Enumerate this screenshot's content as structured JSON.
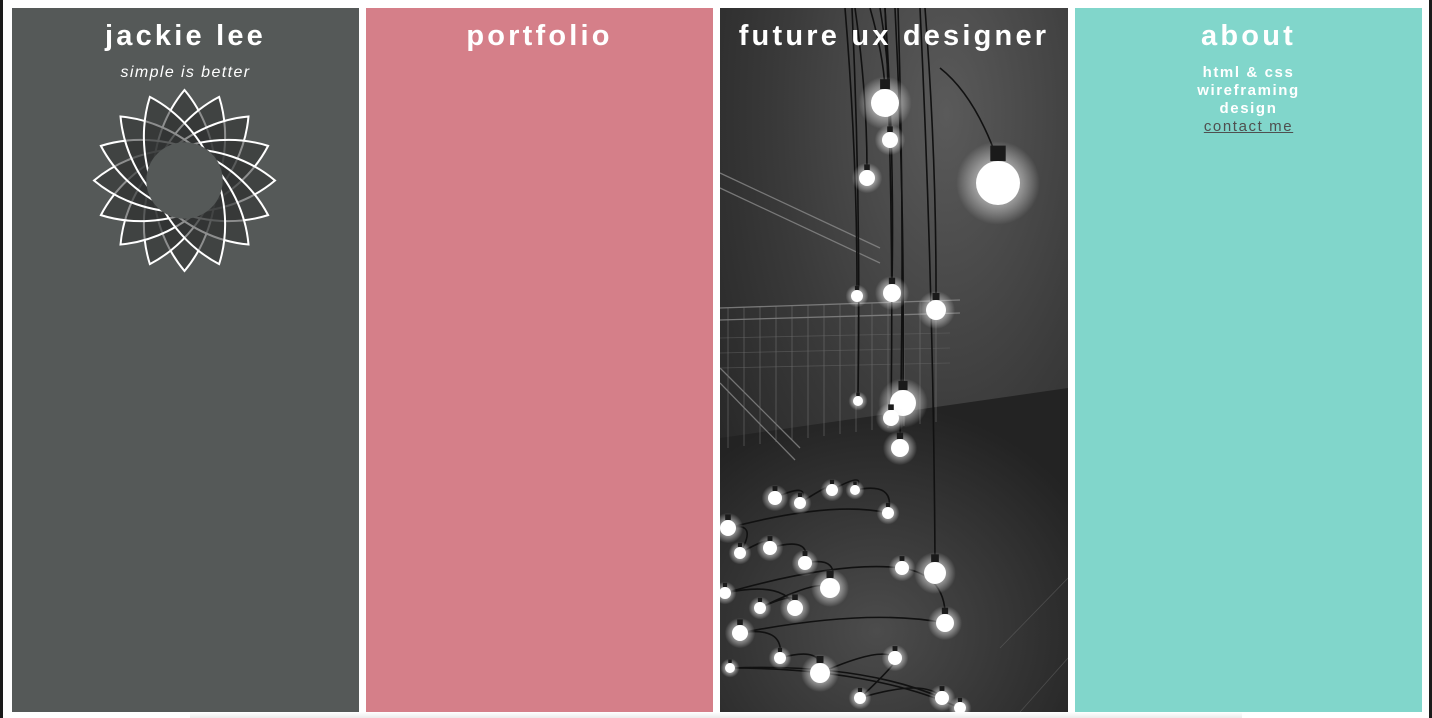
{
  "colors": {
    "panel_1": "#555958",
    "panel_2": "#d57f89",
    "panel_3": "#3a3a3a",
    "panel_4": "#81d6cb",
    "text": "#ffffff",
    "link": "#4f4f4f"
  },
  "panels": {
    "name": {
      "title": "jackie lee",
      "tagline": "simple is better",
      "icon": "flower-logo-icon"
    },
    "portfolio": {
      "title": "portfolio"
    },
    "photo": {
      "title": "future ux designer",
      "image": "hanging-light-bulbs-photo"
    },
    "about": {
      "title": "about",
      "items": [
        "html & css",
        "wireframing",
        "design"
      ],
      "contact_link": "contact me"
    }
  }
}
